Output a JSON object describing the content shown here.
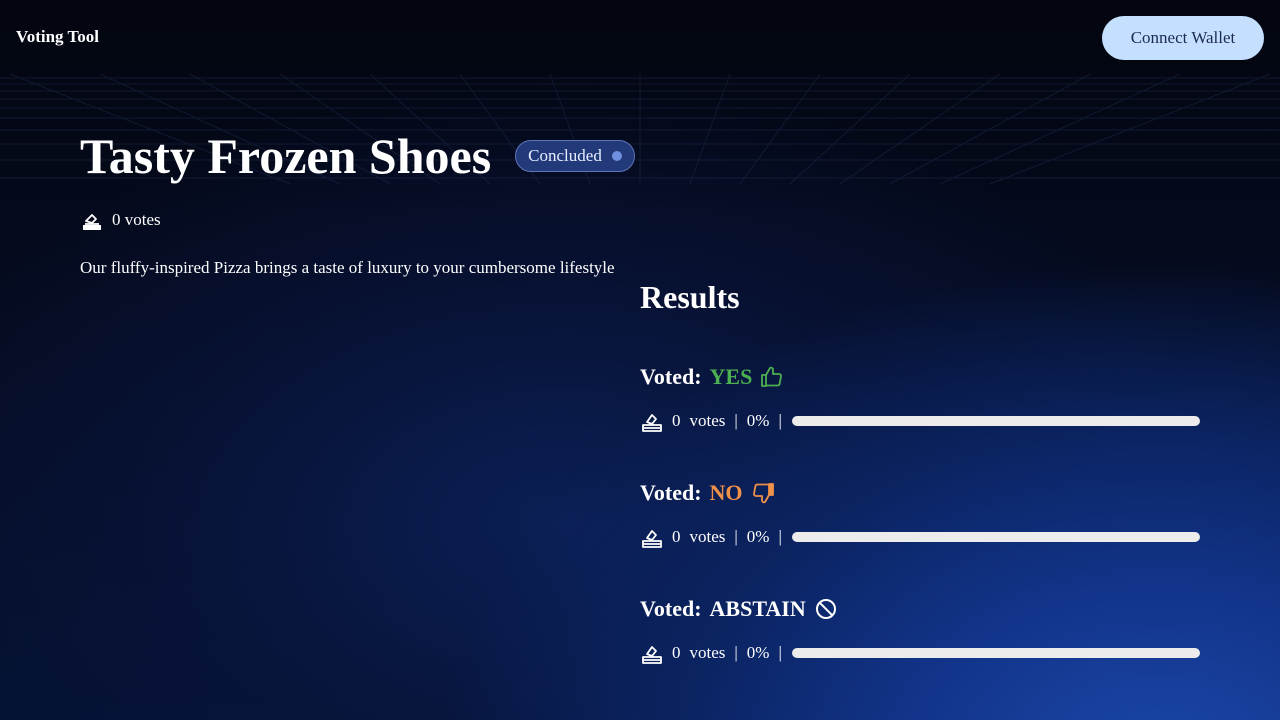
{
  "header": {
    "brand": "Voting Tool",
    "connect_label": "Connect Wallet"
  },
  "proposal": {
    "title": "Tasty Frozen Shoes",
    "status": "Concluded",
    "votes_count": "0",
    "votes_unit": "votes",
    "description": "Our fluffy-inspired Pizza brings a taste of luxury to your cumbersome lifestyle"
  },
  "results": {
    "title": "Results",
    "voted_label": "Voted:",
    "items": [
      {
        "choice": "YES",
        "icon": "thumbs-up-icon",
        "color": "#4caf50",
        "votes": "0",
        "unit": "votes",
        "sep": "|",
        "percent": "0%",
        "fill": 0
      },
      {
        "choice": "NO",
        "icon": "thumbs-down-icon",
        "color": "#f0914a",
        "votes": "0",
        "unit": "votes",
        "sep": "|",
        "percent": "0%",
        "fill": 0
      },
      {
        "choice": "ABSTAIN",
        "icon": "ban-icon",
        "color": "#ffffff",
        "votes": "0",
        "unit": "votes",
        "sep": "|",
        "percent": "0%",
        "fill": 0
      }
    ]
  }
}
